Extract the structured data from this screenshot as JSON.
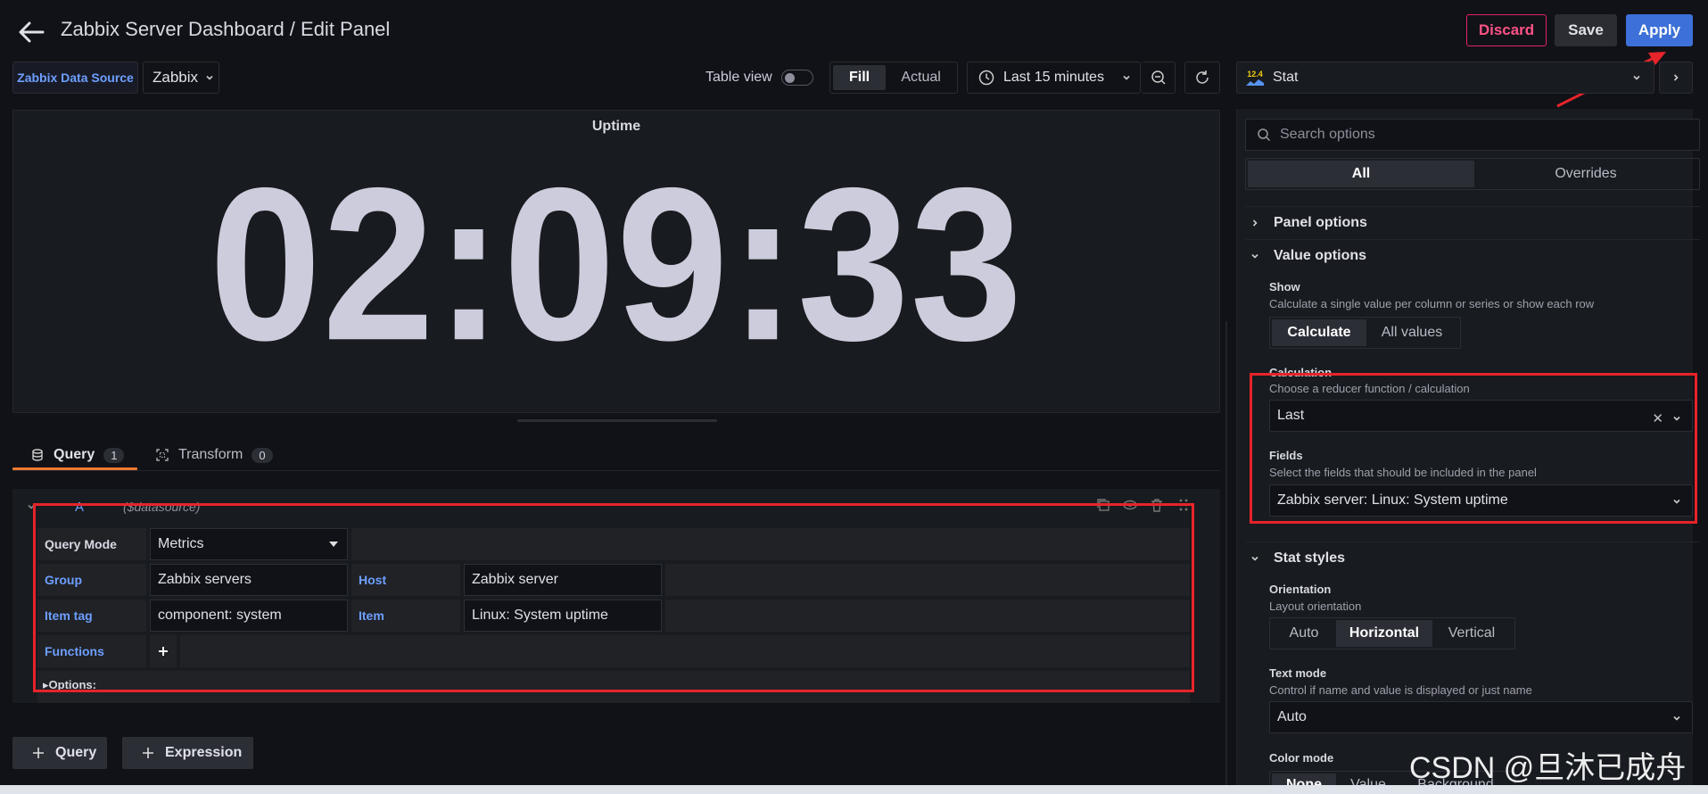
{
  "header": {
    "title": "Zabbix Server Dashboard / Edit Panel",
    "discard_label": "Discard",
    "save_label": "Save",
    "apply_label": "Apply"
  },
  "toolbar": {
    "datasource_label": "Zabbix Data Source",
    "datasource_value": "Zabbix",
    "table_view_label": "Table view",
    "fill_label": "Fill",
    "actual_label": "Actual",
    "time_range": "Last 15 minutes",
    "visualization": "Stat",
    "visualization_icon_text": "12.4"
  },
  "panel": {
    "title": "Uptime",
    "value": "02:09:33"
  },
  "tabs": [
    {
      "label": "Query",
      "count": "1"
    },
    {
      "label": "Transform",
      "count": "0"
    }
  ],
  "query": {
    "ref_id": "A",
    "datasource": "($datasource)",
    "query_mode_label": "Query Mode",
    "query_mode_value": "Metrics",
    "group_label": "Group",
    "group_value": "Zabbix servers",
    "host_label": "Host",
    "host_value": "Zabbix server",
    "item_tag_label": "Item tag",
    "item_tag_value": "component: system",
    "item_label": "Item",
    "item_value": "Linux: System uptime",
    "functions_label": "Functions",
    "options_label": "Options:"
  },
  "add_buttons": {
    "query": "Query",
    "expression": "Expression"
  },
  "options_pane": {
    "search_placeholder": "Search options",
    "tab_all": "All",
    "tab_overrides": "Overrides",
    "panel_options": "Panel options",
    "value_options": "Value options",
    "show_label": "Show",
    "show_desc": "Calculate a single value per column or series or show each row",
    "show_calculate": "Calculate",
    "show_all_values": "All values",
    "calculation_label": "Calculation",
    "calculation_desc": "Choose a reducer function / calculation",
    "calculation_value": "Last",
    "fields_label": "Fields",
    "fields_desc": "Select the fields that should be included in the panel",
    "fields_value": "Zabbix server: Linux: System uptime",
    "stat_styles": "Stat styles",
    "orientation_label": "Orientation",
    "orientation_desc": "Layout orientation",
    "orientation_auto": "Auto",
    "orientation_horizontal": "Horizontal",
    "orientation_vertical": "Vertical",
    "text_mode_label": "Text mode",
    "text_mode_desc": "Control if name and value is displayed or just name",
    "text_mode_value": "Auto",
    "color_mode_label": "Color mode",
    "color_mode_none": "None",
    "color_mode_value": "Value",
    "color_mode_background": "Background"
  },
  "watermark": "CSDN @旦沐已成舟",
  "colors": {
    "accent_orange": "#f07a30",
    "apply_blue": "#3d71d9",
    "discard_pink": "#ff5286",
    "annotation_red": "#e6242a"
  }
}
